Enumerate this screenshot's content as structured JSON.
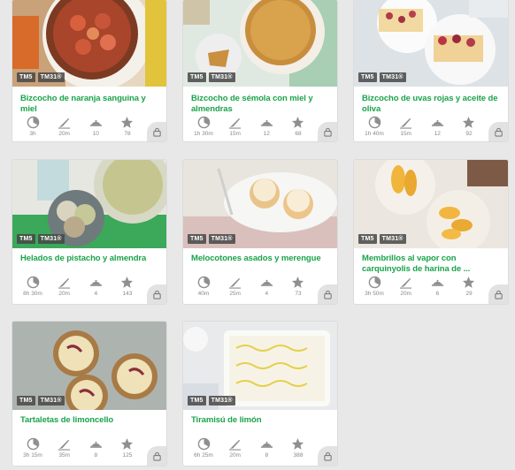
{
  "badges": [
    "TM5",
    "TM31®"
  ],
  "colors": {
    "accent": "#1aa34a",
    "icon": "#8f8f8f",
    "lock_bg": "#e2e2e2"
  },
  "stat_icons": [
    "prep-time-icon",
    "difficulty-knife-icon",
    "servings-dish-icon",
    "rating-star-icon"
  ],
  "recipes": [
    {
      "title": "Bizcocho de naranja sanguina y miel",
      "time": "3h",
      "prep": "20m",
      "servings": "10",
      "rating": "78",
      "photo": "orange-cake"
    },
    {
      "title": "Bizcocho de sémola con miel y almendras",
      "time": "1h 30m",
      "prep": "15m",
      "servings": "12",
      "rating": "68",
      "photo": "semolina-cake"
    },
    {
      "title": "Bizcocho de uvas rojas y aceite de oliva",
      "time": "1h 40m",
      "prep": "15m",
      "servings": "12",
      "rating": "92",
      "photo": "grape-cake"
    },
    {
      "title": "Helados de pistacho y almendra",
      "time": "8h 30m",
      "prep": "20m",
      "servings": "4",
      "rating": "143",
      "photo": "pistachio-icecream"
    },
    {
      "title": "Melocotones asados y merengue",
      "time": "40m",
      "prep": "25m",
      "servings": "4",
      "rating": "73",
      "photo": "meringue-peaches"
    },
    {
      "title": "Membrillos al vapor con carquinyolis de harina de ...",
      "time": "3h 50m",
      "prep": "20m",
      "servings": "6",
      "rating": "29",
      "photo": "quince"
    },
    {
      "title": "Tartaletas de limoncello",
      "time": "3h 15m",
      "prep": "35m",
      "servings": "8",
      "rating": "125",
      "photo": "limoncello-tarts"
    },
    {
      "title": "Tiramisú de limón",
      "time": "6h 25m",
      "prep": "20m",
      "servings": "8",
      "rating": "388",
      "photo": "lemon-tiramisu"
    }
  ]
}
